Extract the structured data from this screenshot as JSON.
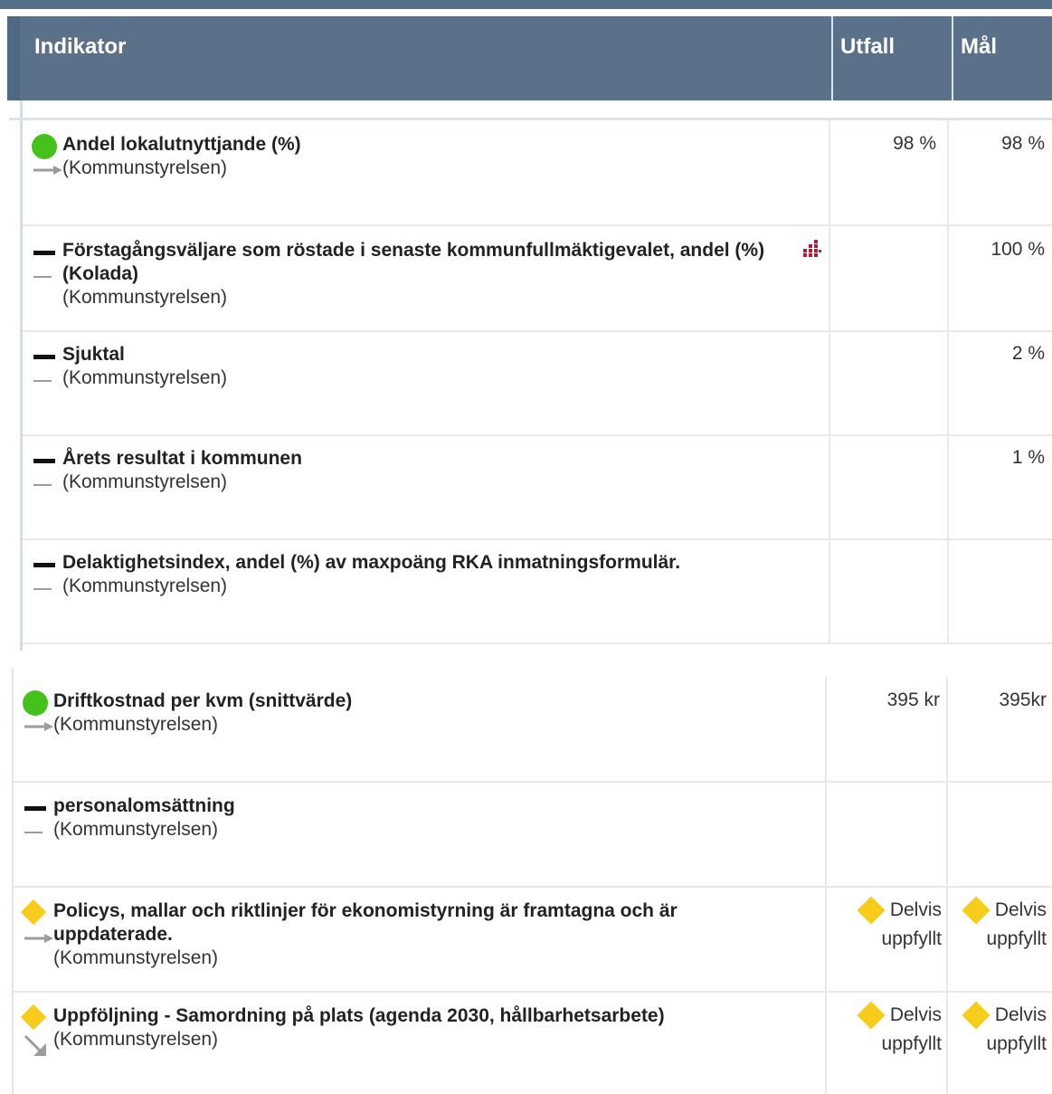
{
  "header": {
    "indicator": "Indikator",
    "outcome": "Utfall",
    "target": "Mål"
  },
  "rows_top": [
    {
      "status": "green-dot",
      "trend": "arrow-right",
      "title": "Andel lokalutnyttjande (%)",
      "unit": "(Kommunstyrelsen)",
      "outcome": "98 %",
      "target": "98 %"
    },
    {
      "status": "dash",
      "trend": "none",
      "title": "Förstagångsväljare som röstade i senaste kommunfullmäktigevalet, andel (%)",
      "title2": "(Kolada)",
      "unit": "(Kommunstyrelsen)",
      "outcome": "",
      "target": "100 %",
      "chart_icon": true
    },
    {
      "status": "dash",
      "trend": "none",
      "title": "Sjuktal",
      "unit": "(Kommunstyrelsen)",
      "outcome": "",
      "target": "2 %"
    },
    {
      "status": "dash",
      "trend": "none",
      "title": "Årets resultat i kommunen",
      "unit": "(Kommunstyrelsen)",
      "outcome": "",
      "target": "1 %"
    },
    {
      "status": "dash",
      "trend": "none",
      "title": "Delaktighetsindex, andel (%) av maxpoäng RKA inmatningsformulär.",
      "unit": "(Kommunstyrelsen)",
      "outcome": "",
      "target": ""
    }
  ],
  "rows_bottom": [
    {
      "status": "green-dot",
      "trend": "arrow-right",
      "title": "Driftkostnad per kvm (snittvärde)",
      "unit": "(Kommunstyrelsen)",
      "outcome": "395 kr",
      "target": "395kr"
    },
    {
      "status": "dash",
      "trend": "none",
      "title": "personalomsättning",
      "unit": "(Kommunstyrelsen)",
      "outcome": "",
      "target": ""
    },
    {
      "status": "yellow-diamond",
      "trend": "arrow-right",
      "title": "Policys, mallar och riktlinjer för ekonomistyrning är framtagna och är",
      "title2": "uppdaterade.",
      "unit": "(Kommunstyrelsen)",
      "outcome_line1": "Delvis",
      "outcome_line2": "uppfyllt",
      "target_line1": "Delvis",
      "target_line2": "uppfyllt"
    },
    {
      "status": "yellow-diamond",
      "trend": "arrow-down-right",
      "title": "Uppföljning - Samordning på plats (agenda 2030, hållbarhetsarbete)",
      "unit": "(Kommunstyrelsen)",
      "outcome_line1": "Delvis",
      "outcome_line2": "uppfyllt",
      "target_line1": "Delvis",
      "target_line2": "uppfyllt"
    }
  ],
  "colors": {
    "header_bg": "#5a7189",
    "green": "#44c21b",
    "yellow": "#f7cc1a",
    "chart_icon": "#b01c3a"
  }
}
